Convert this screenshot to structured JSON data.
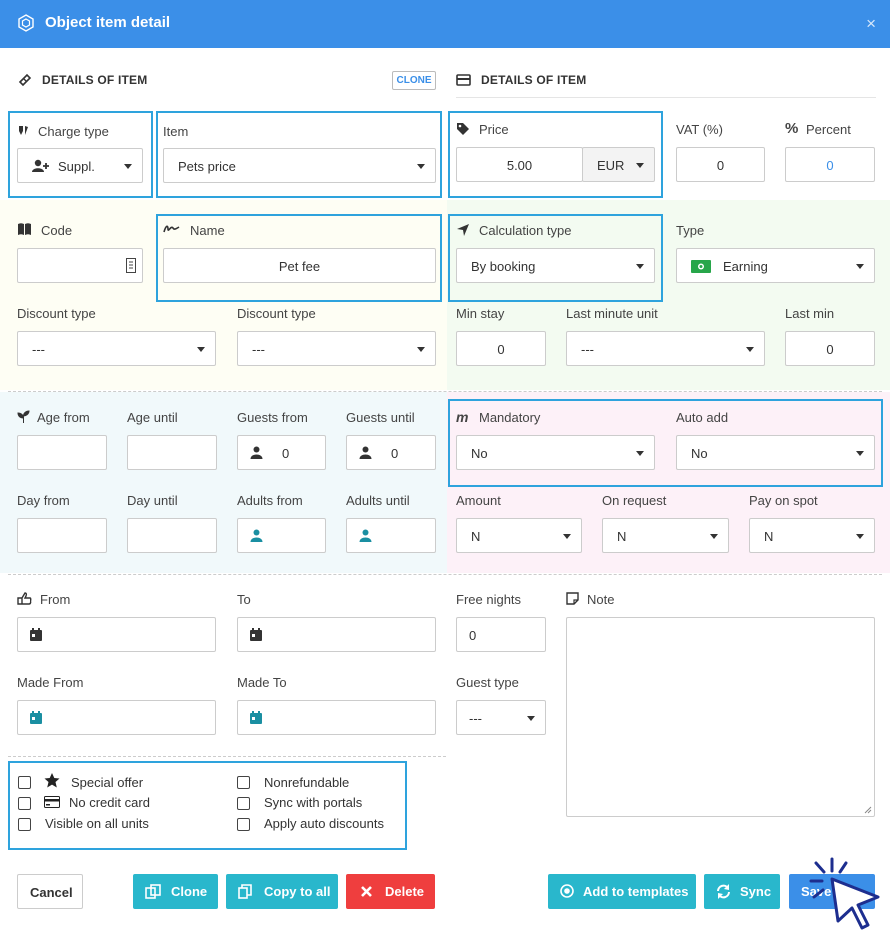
{
  "header": {
    "title": "Object item detail",
    "close_icon": "×"
  },
  "left_section": {
    "title": "DETAILS OF ITEM",
    "clone_label": "CLONE"
  },
  "right_section": {
    "title": "DETAILS OF ITEM"
  },
  "row1": {
    "charge_type": {
      "label": "Charge type",
      "value": "Suppl."
    },
    "item": {
      "label": "Item",
      "value": "Pets price"
    },
    "price": {
      "label": "Price",
      "value": "5.00",
      "currency": "EUR"
    },
    "vat": {
      "label": "VAT (%)",
      "value": "0"
    },
    "percent": {
      "label": "Percent",
      "value": "0"
    }
  },
  "row2": {
    "code": {
      "label": "Code",
      "value": ""
    },
    "name": {
      "label": "Name",
      "value": "Pet fee"
    },
    "calculation_type": {
      "label": "Calculation type",
      "value": "By booking"
    },
    "type": {
      "label": "Type",
      "value": "Earning"
    }
  },
  "row3": {
    "discount_type_1": {
      "label": "Discount type",
      "value": "---"
    },
    "discount_type_2": {
      "label": "Discount type",
      "value": "---"
    },
    "min_stay": {
      "label": "Min stay",
      "value": "0"
    },
    "last_minute_unit": {
      "label": "Last minute unit",
      "value": "---"
    },
    "last_min": {
      "label": "Last min",
      "value": "0"
    }
  },
  "row4": {
    "age_from": {
      "label": "Age from",
      "value": ""
    },
    "age_until": {
      "label": "Age until",
      "value": ""
    },
    "guests_from": {
      "label": "Guests from",
      "value": "0"
    },
    "guests_until": {
      "label": "Guests until",
      "value": "0"
    },
    "mandatory": {
      "label": "Mandatory",
      "value": "No"
    },
    "auto_add": {
      "label": "Auto add",
      "value": "No"
    }
  },
  "row5": {
    "day_from": {
      "label": "Day from",
      "value": ""
    },
    "day_until": {
      "label": "Day until",
      "value": ""
    },
    "adults_from": {
      "label": "Adults from",
      "value": ""
    },
    "adults_until": {
      "label": "Adults until",
      "value": ""
    },
    "amount": {
      "label": "Amount",
      "value": "N"
    },
    "on_request": {
      "label": "On request",
      "value": "N"
    },
    "pay_on_spot": {
      "label": "Pay on spot",
      "value": "N"
    }
  },
  "row6": {
    "from": {
      "label": "From",
      "value": ""
    },
    "to": {
      "label": "To",
      "value": ""
    },
    "free_nights": {
      "label": "Free nights",
      "value": "0"
    },
    "note": {
      "label": "Note",
      "value": ""
    }
  },
  "row7": {
    "made_from": {
      "label": "Made From",
      "value": ""
    },
    "made_to": {
      "label": "Made To",
      "value": ""
    },
    "guest_type": {
      "label": "Guest type",
      "value": "---"
    }
  },
  "checkboxes": {
    "special_offer": "Special offer",
    "no_credit_card": "No credit card",
    "visible_on_all_units": "Visible on all units",
    "nonrefundable": "Nonrefundable",
    "sync_with_portals": "Sync with portals",
    "apply_auto_discounts": "Apply auto discounts"
  },
  "buttons": {
    "cancel": "Cancel",
    "clone": "Clone",
    "copy_to_all": "Copy to all",
    "delete": "Delete",
    "add_to_templates": "Add to templates",
    "sync": "Sync",
    "save": "Save"
  },
  "colors": {
    "primary": "#3b8fe8",
    "teal": "#29b7cc",
    "danger": "#ef3e3e",
    "highlight": "#2ea3dd",
    "green": "#27a64a"
  }
}
